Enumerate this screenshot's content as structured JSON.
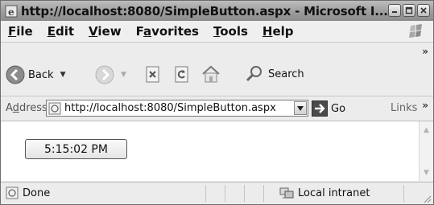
{
  "window": {
    "title": "http://localhost:8080/SimpleButton.aspx - Microsoft I..."
  },
  "menu": {
    "items": [
      {
        "accel": "F",
        "rest": "ile"
      },
      {
        "accel": "E",
        "rest": "dit"
      },
      {
        "accel": "V",
        "rest": "iew"
      },
      {
        "pre": "F",
        "accel": "a",
        "rest": "vorites"
      },
      {
        "accel": "T",
        "rest": "ools"
      },
      {
        "accel": "H",
        "rest": "elp"
      }
    ]
  },
  "toolbar": {
    "back_label": "Back",
    "search_label": "Search",
    "overflow": "»"
  },
  "address": {
    "label_accel": "d",
    "label_pre": "A",
    "label_rest": "dress",
    "url": "http://localhost:8080/SimpleButton.aspx",
    "go_label": "Go",
    "links_label": "Links",
    "links_overflow": "»"
  },
  "content": {
    "time_button_label": "5:15:02 PM"
  },
  "status": {
    "text": "Done",
    "zone": "Local intranet"
  },
  "colors": {
    "go_arrow": "#4a4a4a",
    "chrome": "#ececec"
  }
}
